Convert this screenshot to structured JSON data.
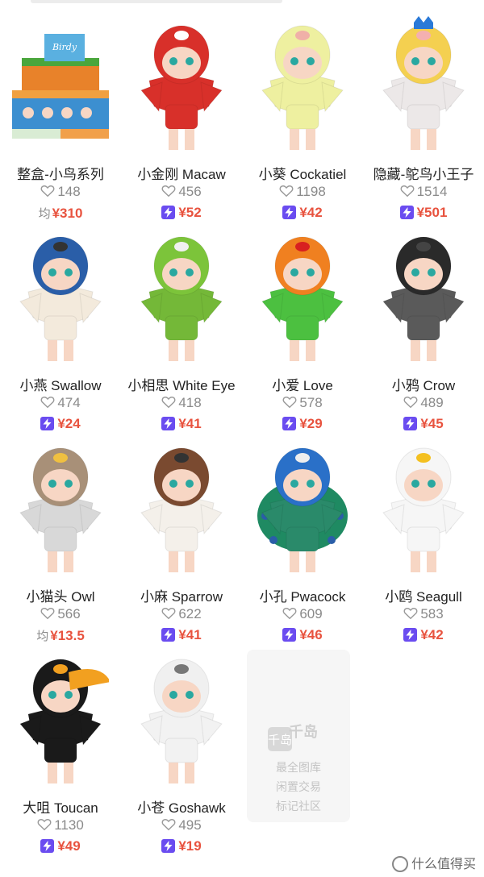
{
  "items": [
    {
      "name": "整盒-小鸟系列",
      "likes": "148",
      "price": "¥310",
      "price_prefix": "均",
      "type": "box"
    },
    {
      "name": "小金刚 Macaw",
      "likes": "456",
      "price": "¥52",
      "price_prefix": "",
      "type": "bird",
      "helmet": "#d8302a",
      "body": "#d8302a",
      "beak": "#ffffff"
    },
    {
      "name": "小葵 Cockatiel",
      "likes": "1198",
      "price": "¥42",
      "price_prefix": "",
      "type": "bird",
      "helmet": "#eef0a0",
      "body": "#eef0a0",
      "beak": "#f0b0a8"
    },
    {
      "name": "隐藏-鸵鸟小王子",
      "likes": "1514",
      "price": "¥501",
      "price_prefix": "",
      "type": "prince",
      "helmet": "#f4d050",
      "body": "#ece8e8",
      "beak": "#f4b0b0"
    },
    {
      "name": "小燕 Swallow",
      "likes": "474",
      "price": "¥24",
      "price_prefix": "",
      "type": "bird",
      "helmet": "#2a5ea8",
      "body": "#f3eadc",
      "beak": "#333333"
    },
    {
      "name": "小相思 White Eye",
      "likes": "418",
      "price": "¥41",
      "price_prefix": "",
      "type": "bird",
      "helmet": "#7cc43a",
      "body": "#74b838",
      "beak": "#f0f0f0"
    },
    {
      "name": "小爱 Love",
      "likes": "578",
      "price": "¥29",
      "price_prefix": "",
      "type": "bird",
      "helmet": "#f08020",
      "body": "#4cc040",
      "beak": "#d82020"
    },
    {
      "name": "小鸦 Crow",
      "likes": "489",
      "price": "¥45",
      "price_prefix": "",
      "type": "bird",
      "helmet": "#2a2a2a",
      "body": "#5a5a5a",
      "beak": "#444444"
    },
    {
      "name": "小猫头 Owl",
      "likes": "566",
      "price": "¥13.5",
      "price_prefix": "均",
      "type": "bird",
      "helmet": "#a89078",
      "body": "#d8d8d8",
      "beak": "#f0c040"
    },
    {
      "name": "小麻 Sparrow",
      "likes": "622",
      "price": "¥41",
      "price_prefix": "",
      "type": "bird",
      "helmet": "#7a4a30",
      "body": "#f4f0ea",
      "beak": "#333333"
    },
    {
      "name": "小孔 Pwacock",
      "likes": "609",
      "price": "¥46",
      "price_prefix": "",
      "type": "peacock",
      "helmet": "#2a70c8",
      "body": "#2a8a6a",
      "beak": "#eeeeee"
    },
    {
      "name": "小鸥 Seagull",
      "likes": "583",
      "price": "¥42",
      "price_prefix": "",
      "type": "bird",
      "helmet": "#f6f6f6",
      "body": "#f6f6f6",
      "beak": "#f4c020"
    },
    {
      "name": "大咀 Toucan",
      "likes": "1130",
      "price": "¥49",
      "price_prefix": "",
      "type": "toucan",
      "helmet": "#1a1a1a",
      "body": "#1a1a1a",
      "beak": "#f2a020"
    },
    {
      "name": "小苍 Goshawk",
      "likes": "495",
      "price": "¥19",
      "price_prefix": "",
      "type": "bird",
      "helmet": "#f0f0f0",
      "body": "#f2f2f2",
      "beak": "#777777"
    }
  ],
  "watermark": {
    "brand": "千岛",
    "lines": [
      "最全图库",
      "闲置交易",
      "标记社区"
    ]
  },
  "footer": {
    "site": "什么值得买"
  },
  "colors": {
    "price": "#e8533f",
    "bolt_badge": "#6a4cf0",
    "skin": "#f7d6c4",
    "eye": "#2aa8a0"
  }
}
